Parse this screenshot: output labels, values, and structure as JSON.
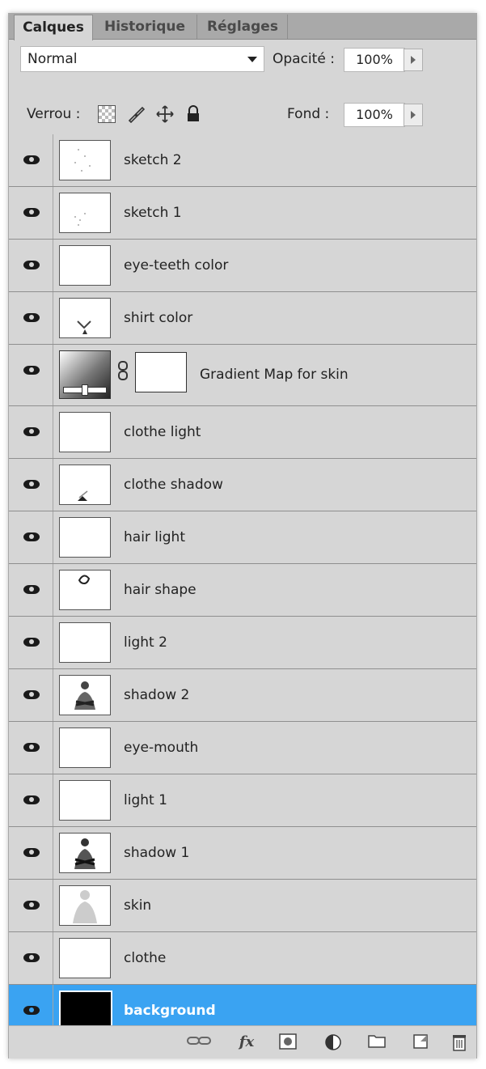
{
  "tabs": [
    {
      "label": "Calques"
    },
    {
      "label": "Historique"
    },
    {
      "label": "Réglages"
    }
  ],
  "blend_mode": "Normal",
  "opacity": {
    "label": "Opacité :",
    "value": "100%"
  },
  "lock": {
    "label": "Verrou :"
  },
  "fill": {
    "label": "Fond :",
    "value": "100%"
  },
  "layers": [
    {
      "name": "sketch 2"
    },
    {
      "name": "sketch 1"
    },
    {
      "name": "eye-teeth color"
    },
    {
      "name": "shirt color"
    },
    {
      "name": "Gradient Map for skin"
    },
    {
      "name": "clothe light"
    },
    {
      "name": "clothe shadow"
    },
    {
      "name": "hair light"
    },
    {
      "name": "hair shape"
    },
    {
      "name": "light 2"
    },
    {
      "name": "shadow 2"
    },
    {
      "name": "eye-mouth"
    },
    {
      "name": "light 1"
    },
    {
      "name": "shadow 1"
    },
    {
      "name": "skin"
    },
    {
      "name": "clothe"
    },
    {
      "name": "background",
      "selected": true
    }
  ],
  "toolbar": {
    "link_icon": "link-icon",
    "fx_label": "fx",
    "mask_icon": "add-mask-icon",
    "adjust_icon": "adjustment-layer-icon",
    "group_icon": "new-group-folder-icon",
    "new_layer_icon": "new-layer-icon",
    "trash_icon": "trash-icon"
  },
  "colors": {
    "panel": "#d6d6d6",
    "selected": "#3aa3f2",
    "tabbar": "#a9a9a9"
  }
}
